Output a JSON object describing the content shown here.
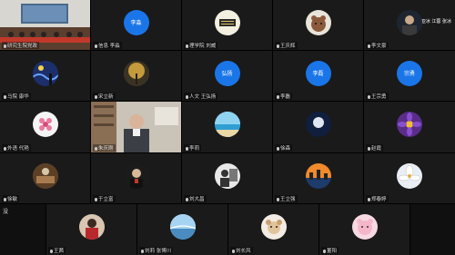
{
  "colors": {
    "blue_avatar": "#1a76e8",
    "active_border": "#3aa84a"
  },
  "top_right_tag": "王亚冰 江蓉 张冰",
  "bottom_left_label": "没",
  "participants": [
    {
      "name": "研究生院党政",
      "avatar": "photo-room"
    },
    {
      "name": "信息 李淼",
      "avatar_text": "李淼",
      "avatar": "text"
    },
    {
      "name": "理学院 刘威",
      "avatar": "photo-card"
    },
    {
      "name": "王庆辉",
      "avatar": "photo-bear"
    },
    {
      "name": "李文豪",
      "avatar": "photo-dark-person"
    },
    {
      "name": "马院 康华",
      "avatar": "photo-starry"
    },
    {
      "name": "宋立新",
      "avatar": "photo-tree"
    },
    {
      "name": "人文 王弘扬",
      "avatar_text": "弘扬",
      "avatar": "text"
    },
    {
      "name": "李磊",
      "avatar_text": "李磊",
      "avatar": "text"
    },
    {
      "name": "王宗勇",
      "avatar_text": "宗勇",
      "avatar": "text"
    },
    {
      "name": "外语 代艳",
      "avatar": "photo-flower"
    },
    {
      "name": "朱庆刚",
      "avatar": "video-person"
    },
    {
      "name": "李莉",
      "avatar": "photo-beach"
    },
    {
      "name": "徐森",
      "avatar": "photo-moon"
    },
    {
      "name": "赵霞",
      "avatar": "photo-purple"
    },
    {
      "name": "徐敏",
      "avatar": "photo-room2"
    },
    {
      "name": "于立富",
      "avatar": "photo-person-dark"
    },
    {
      "name": "刘大昌",
      "avatar": "photo-sketch"
    },
    {
      "name": "王立强",
      "avatar": "photo-city"
    },
    {
      "name": "郑春婷",
      "avatar": "photo-lily"
    },
    {
      "name": "王茜",
      "avatar": "photo-woman-red"
    },
    {
      "name": "刘莉 张博川",
      "avatar": "photo-bridge"
    },
    {
      "name": "刘长风",
      "avatar": "photo-dog"
    },
    {
      "name": "董阳",
      "avatar": "photo-pink"
    }
  ]
}
